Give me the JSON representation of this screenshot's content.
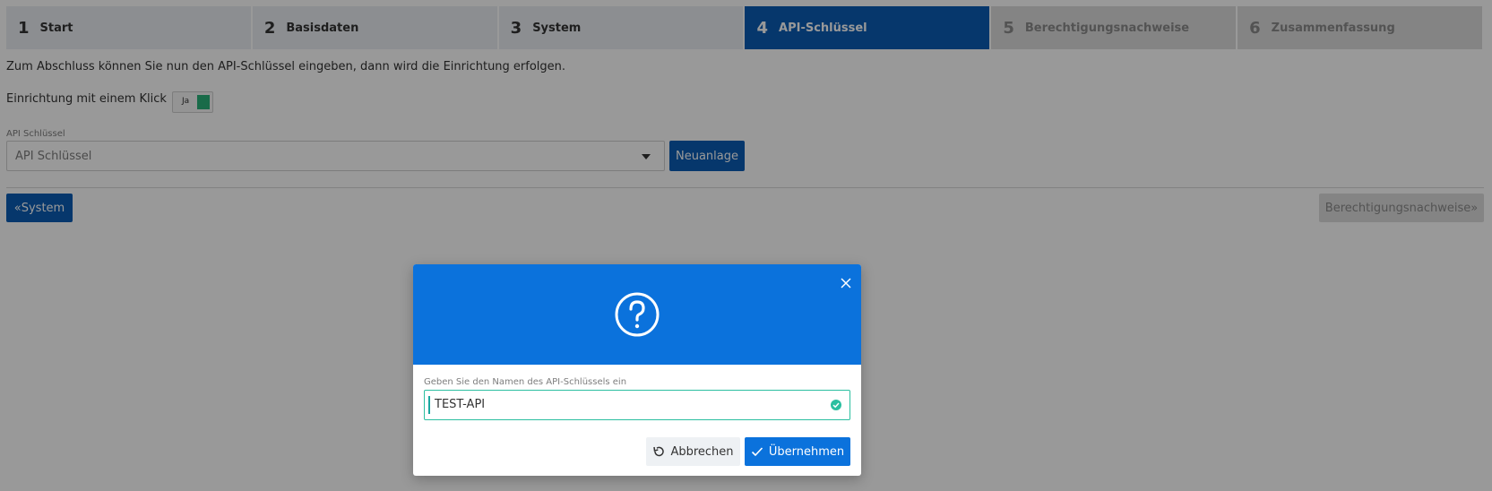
{
  "steps": [
    {
      "num": "1",
      "label": "Start"
    },
    {
      "num": "2",
      "label": "Basisdaten"
    },
    {
      "num": "3",
      "label": "System"
    },
    {
      "num": "4",
      "label": "API-Schlüssel"
    },
    {
      "num": "5",
      "label": "Berechtigungsnachweise"
    },
    {
      "num": "6",
      "label": "Zusammenfassung"
    }
  ],
  "intro_text": "Zum Abschluss können Sie nun den API-Schlüssel eingeben, dann wird die Einrichtung erfolgen.",
  "oneclick": {
    "label": "Einrichtung mit einem Klick",
    "toggle_label": "Ja"
  },
  "api_key": {
    "label": "API Schlüssel",
    "placeholder": "API Schlüssel"
  },
  "buttons": {
    "new": "Neuanlage",
    "back": "System",
    "next": "Berechtigungsnachweise"
  },
  "modal": {
    "field_label": "Geben Sie den Namen des API-Schlüssels ein",
    "field_value": "TEST-API",
    "cancel": "Abbrechen",
    "apply": "Übernehmen"
  },
  "colors": {
    "primary": "#0b5cb5",
    "modal_header": "#0b72dc",
    "valid": "#2bbfa0",
    "toggle_on": "#2ab37a"
  },
  "icons": [
    "question-circle-icon",
    "close-icon",
    "check-circle-icon",
    "undo-icon",
    "check-icon",
    "double-chevron-left-icon",
    "double-chevron-right-icon",
    "caret-down-icon"
  ]
}
